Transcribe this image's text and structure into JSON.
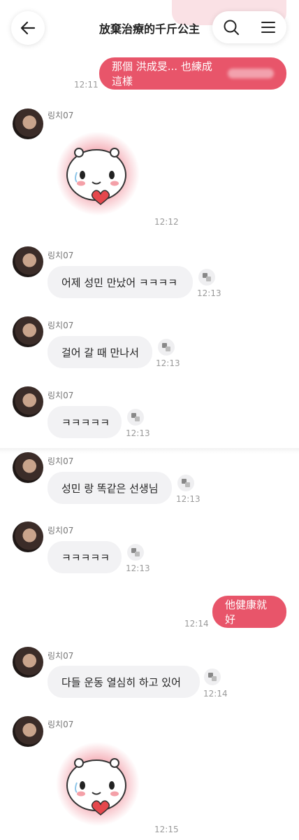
{
  "header": {
    "title": "放棄治療的千斤公主",
    "back_icon": "arrow-left-icon",
    "search_icon": "search-icon",
    "menu_icon": "hamburger-menu-icon"
  },
  "colors": {
    "accent": "#e8556a",
    "bubble_in": "#f2f2f4",
    "time": "#9a9a9a"
  },
  "messages": {
    "m1": {
      "text": "那個 洪成旻... 也練成這樣",
      "time": "12:11"
    },
    "m2": {
      "sender": "링치07",
      "sticker": "crying-hamster-heart-sticker",
      "time": "12:12"
    },
    "m3": {
      "sender": "링치07",
      "text": "어제 성민 만났어 ㅋㅋㅋㅋ",
      "time": "12:13"
    },
    "m4": {
      "sender": "링치07",
      "text": "걸어 갈 때 만나서",
      "time": "12:13"
    },
    "m5": {
      "sender": "링치07",
      "text": "ㅋㅋㅋㅋㅋ",
      "time": "12:13"
    },
    "m6": {
      "sender": "링치07",
      "text": "성민 랑 똑같은 선생님",
      "time": "12:13"
    },
    "m7": {
      "sender": "링치07",
      "text": "ㅋㅋㅋㅋㅋ",
      "time": "12:13"
    },
    "m8": {
      "text": "他健康就好",
      "time": "12:14"
    },
    "m9": {
      "sender": "링치07",
      "text": "다들 운동 열심히 하고 있어",
      "time": "12:14"
    },
    "m10": {
      "sender": "링치07",
      "sticker": "crying-hamster-heart-sticker",
      "time": "12:15"
    }
  }
}
